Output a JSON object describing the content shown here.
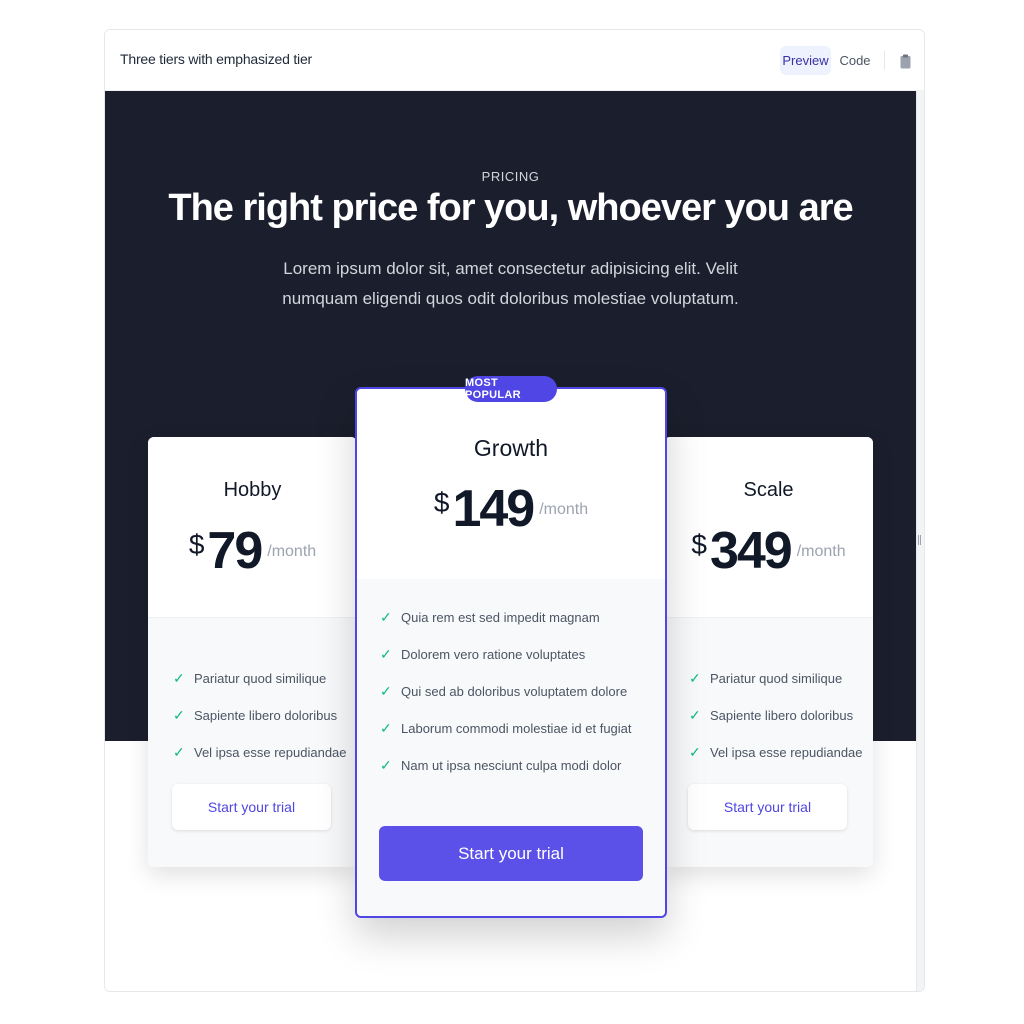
{
  "topbar": {
    "title": "Three tiers with emphasized tier",
    "tab_preview": "Preview",
    "tab_code": "Code",
    "copy_icon": "clipboard-icon"
  },
  "hero": {
    "eyebrow": "PRICING",
    "headline": "The right price for you, whoever you are",
    "subtext": "Lorem ipsum dolor sit, amet consectetur adipisicing elit. Velit numquam eligendi quos odit doloribus molestiae voluptatum."
  },
  "tiers": [
    {
      "name": "Hobby",
      "currency": "$",
      "price": "79",
      "period": "/month",
      "features": [
        "Pariatur quod similique",
        "Sapiente libero doloribus",
        "Vel ipsa esse repudiandae"
      ],
      "cta": "Start your trial"
    },
    {
      "name": "Growth",
      "badge": "MOST POPULAR",
      "currency": "$",
      "price": "149",
      "period": "/month",
      "features": [
        "Quia rem est sed impedit magnam",
        "Dolorem vero ratione voluptates",
        "Qui sed ab doloribus voluptatem dolore",
        "Laborum commodi molestiae id et fugiat",
        "Nam ut ipsa nesciunt culpa modi dolor"
      ],
      "cta": "Start your trial"
    },
    {
      "name": "Scale",
      "currency": "$",
      "price": "349",
      "period": "/month",
      "features": [
        "Pariatur quod similique",
        "Sapiente libero doloribus",
        "Vel ipsa esse repudiandae"
      ],
      "cta": "Start your trial"
    }
  ],
  "check_icon": "✓",
  "colors": {
    "hero_bg": "#1b1f2d",
    "accent": "#4f46e5",
    "check": "#10b981"
  }
}
